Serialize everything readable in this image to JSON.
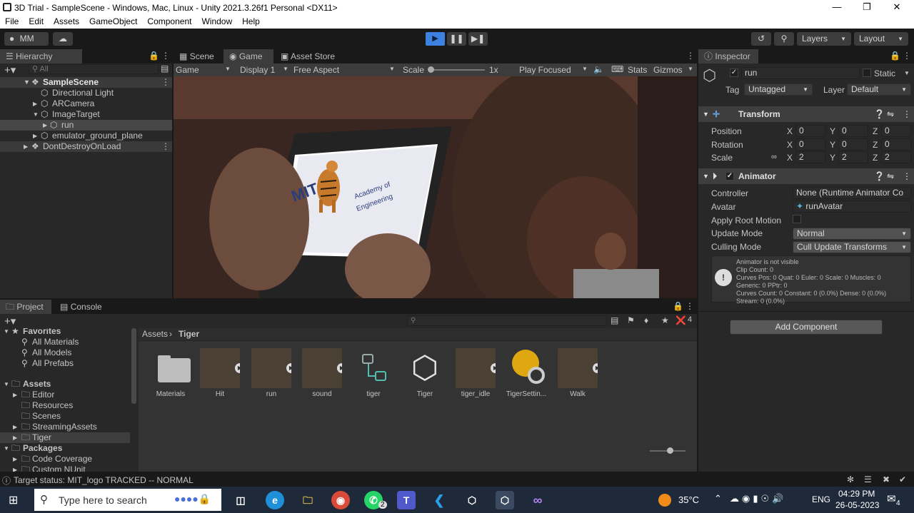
{
  "window": {
    "title": "3D Trial - SampleScene - Windows, Mac, Linux - Unity 2021.3.26f1 Personal <DX11>",
    "minimize": "—",
    "maximize": "❐",
    "close": "✕"
  },
  "menu": [
    "File",
    "Edit",
    "Assets",
    "GameObject",
    "Component",
    "Window",
    "Help"
  ],
  "toolbar": {
    "account": "MM",
    "layers": "Layers",
    "layout": "Layout"
  },
  "hierarchy": {
    "tab": "Hierarchy",
    "search_placeholder": "All",
    "items": [
      {
        "label": "SampleScene"
      },
      {
        "label": "Directional Light"
      },
      {
        "label": "ARCamera"
      },
      {
        "label": "ImageTarget"
      },
      {
        "label": "run"
      },
      {
        "label": "emulator_ground_plane"
      },
      {
        "label": "DontDestroyOnLoad"
      }
    ]
  },
  "game_view": {
    "tabs": [
      "Scene",
      "Game",
      "Asset Store"
    ],
    "display_mode": "Game",
    "display": "Display 1",
    "aspect": "Free Aspect",
    "scale_label": "Scale",
    "scale_value": "1x",
    "play_mode": "Play Focused",
    "stats": "Stats",
    "gizmos": "Gizmos",
    "image_overlay": {
      "brand": "MIT",
      "line1": "Academy of",
      "line2": "Engineering"
    }
  },
  "project": {
    "tabs": [
      "Project",
      "Console"
    ],
    "hidden_count": "4",
    "favorites": {
      "label": "Favorites",
      "items": [
        "All Materials",
        "All Models",
        "All Prefabs"
      ]
    },
    "assets": {
      "label": "Assets",
      "items": [
        "Editor",
        "Resources",
        "Scenes",
        "StreamingAssets",
        "Tiger"
      ]
    },
    "packages": {
      "label": "Packages",
      "items": [
        "Code Coverage",
        "Custom NUnit"
      ]
    },
    "breadcrumb": [
      "Assets",
      "Tiger"
    ],
    "files": [
      {
        "name": "Materials",
        "kind": "folder"
      },
      {
        "name": "Hit",
        "kind": "anim"
      },
      {
        "name": "run",
        "kind": "anim"
      },
      {
        "name": "sound",
        "kind": "anim"
      },
      {
        "name": "tiger",
        "kind": "controller"
      },
      {
        "name": "Tiger",
        "kind": "prefab"
      },
      {
        "name": "tiger_idle",
        "kind": "anim"
      },
      {
        "name": "TigerSettin...",
        "kind": "settings"
      },
      {
        "name": "Walk",
        "kind": "anim"
      }
    ]
  },
  "inspector": {
    "tab": "Inspector",
    "object_name": "run",
    "static_label": "Static",
    "tag_label": "Tag",
    "tag_value": "Untagged",
    "layer_label": "Layer",
    "layer_value": "Default",
    "transform": {
      "title": "Transform",
      "rows": [
        {
          "label": "Position",
          "x": "0",
          "y": "0",
          "z": "0"
        },
        {
          "label": "Rotation",
          "x": "0",
          "y": "0",
          "z": "0"
        },
        {
          "label": "Scale",
          "x": "2",
          "y": "2",
          "z": "2"
        }
      ]
    },
    "animator": {
      "title": "Animator",
      "controller_label": "Controller",
      "controller_value": "None (Runtime Animator Co",
      "avatar_label": "Avatar",
      "avatar_value": "runAvatar",
      "apply_root_label": "Apply Root Motion",
      "update_mode_label": "Update Mode",
      "update_mode_value": "Normal",
      "culling_label": "Culling Mode",
      "culling_value": "Cull Update Transforms",
      "info": [
        "Animator is not visible",
        "Clip Count: 0",
        "Curves Pos: 0 Quat: 0 Euler: 0 Scale: 0 Muscles: 0",
        "Generic: 0 PPtr: 0",
        "Curves Count: 0 Constant: 0 (0.0%) Dense: 0 (0.0%)",
        "Stream: 0 (0.0%)"
      ]
    },
    "add_component": "Add Component"
  },
  "status_bar": {
    "message": "Target status: MIT_logo TRACKED -- NORMAL"
  },
  "taskbar": {
    "search_placeholder": "Type here to search",
    "whatsapp_badge": "2",
    "temperature": "35°C",
    "language": "ENG",
    "time": "04:29 PM",
    "date": "26-05-2023",
    "notifications": "4"
  },
  "colors": {
    "accent_blue": "#3d82e0",
    "panel": "#282828",
    "dark": "#191919",
    "selected_row": "#3e3e3e"
  }
}
